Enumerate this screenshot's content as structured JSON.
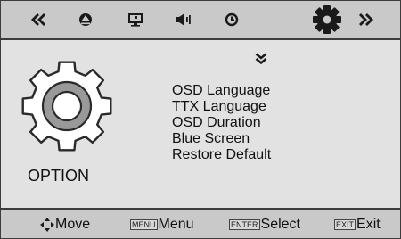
{
  "osd": {
    "menu_tabs": [
      {
        "icon": "double-left-chevron-icon",
        "selected": false
      },
      {
        "icon": "picture-icon",
        "selected": false
      },
      {
        "icon": "screen-icon",
        "selected": false
      },
      {
        "icon": "speaker-icon",
        "selected": false
      },
      {
        "icon": "clock-icon",
        "selected": false
      },
      {
        "icon": "gear-icon",
        "selected": true
      },
      {
        "icon": "double-right-chevron-icon",
        "selected": false
      }
    ],
    "category": {
      "label": "OPTION",
      "icon": "gear-icon"
    },
    "items": [
      "OSD Language",
      "TTX Language",
      "OSD Duration",
      "Blue Screen",
      "Restore Default"
    ],
    "footer": {
      "move": {
        "icon": "four-way-arrow-icon",
        "label": "Move"
      },
      "menu": {
        "key": "MENU",
        "label": "Menu"
      },
      "select": {
        "key": "ENTER",
        "label": "Select"
      },
      "exit": {
        "key": "EXIT",
        "label": "Exit"
      }
    }
  },
  "colors": {
    "panel_bg": "#e2e2e2",
    "bar_bg": "#c9c9c9",
    "border": "#3c3c3c",
    "icon": "#1a1a1a",
    "gear_fill": "#999999"
  }
}
